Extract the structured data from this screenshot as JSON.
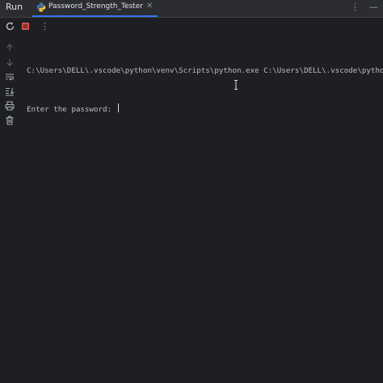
{
  "toolwindow": {
    "title": "Run"
  },
  "tab": {
    "label": "Password_Strength_Tester",
    "close_glyph": "✕"
  },
  "top_icons": {
    "more_glyph": "⋮",
    "minimize_glyph": "—"
  },
  "toolbar": {
    "more_glyph": "⋮"
  },
  "console": {
    "command_line": "C:\\Users\\DELL\\.vscode\\python\\venv\\Scripts\\python.exe C:\\Users\\DELL\\.vscode\\python\\",
    "prompt": "Enter the password: "
  },
  "colors": {
    "background": "#1e1f22",
    "tab_underline": "#3574f0",
    "stop_button": "#db5c5c",
    "rerun": "#c9ccd1"
  }
}
